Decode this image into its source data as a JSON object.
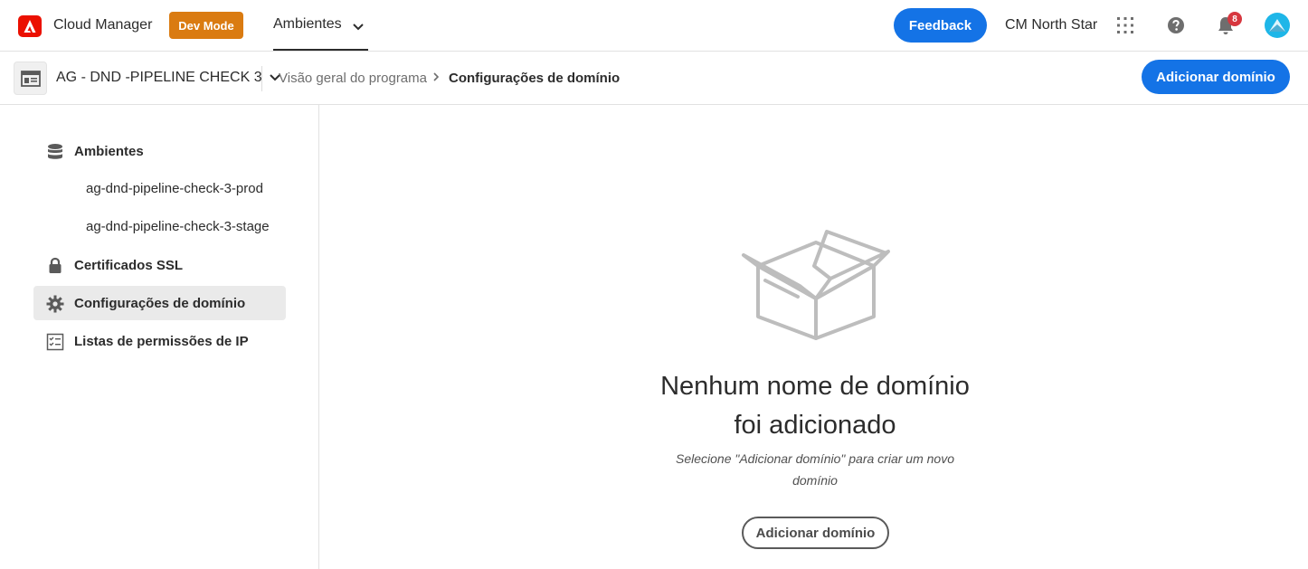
{
  "header": {
    "app_title": "Cloud Manager",
    "dev_mode_label": "Dev Mode",
    "nav_environments": "Ambientes",
    "feedback_label": "Feedback",
    "org_name": "CM North Star",
    "notification_count": "8",
    "brand_color": "#eb1000",
    "accent_color": "#1473e6"
  },
  "subheader": {
    "program_name": "AG - DND -PIPELINE CHECK 3",
    "breadcrumb": [
      "Visão geral do programa",
      "Configurações de domínio"
    ],
    "add_domain_label": "Adicionar domínio"
  },
  "sidebar": {
    "environments_label": "Ambientes",
    "environment_items": [
      "ag-dnd-pipeline-check-3-prod",
      "ag-dnd-pipeline-check-3-stage"
    ],
    "ssl_label": "Certificados SSL",
    "domain_settings_label": "Configurações de domínio",
    "ip_allowlists_label": "Listas de permissões de IP",
    "icons": [
      "database-icon",
      "lock-icon",
      "gear-icon",
      "checklist-icon"
    ]
  },
  "empty_state": {
    "title_line1": "Nenhum nome de domínio",
    "title_line2": "foi adicionado",
    "description_line1": "Selecione \"Adicionar domínio\" para criar um novo",
    "description_line2": "domínio",
    "button_label": "Adicionar domínio"
  }
}
